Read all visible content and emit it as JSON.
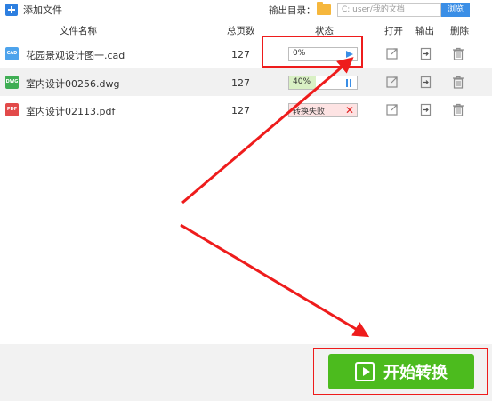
{
  "toolbar": {
    "add_file_label": "添加文件",
    "output_dir_label": "输出目录：",
    "output_path": "C:  user/我的文档",
    "browse_label": "浏览"
  },
  "table": {
    "headers": {
      "name": "文件名称",
      "pages": "总页数",
      "status": "状态",
      "open": "打开",
      "output": "输出",
      "delete": "删除"
    },
    "rows": [
      {
        "icon_text": "CAD",
        "icon_color": "#4da3ec",
        "name": "花园景观设计图一.cad",
        "pages": "127",
        "status_text": "0%",
        "progress": 0,
        "status_fill": "#ffffff",
        "status_action": "play-icon"
      },
      {
        "icon_text": "DWG",
        "icon_color": "#3fae54",
        "name": "室内设计00256.dwg",
        "pages": "127",
        "status_text": "40%",
        "progress": 0.4,
        "status_fill": "#d9f0c4",
        "status_action": "pause-icon"
      },
      {
        "icon_text": "PDF",
        "icon_color": "#e24a4a",
        "name": "室内设计02113.pdf",
        "pages": "127",
        "status_text": "转换失败",
        "progress": 1,
        "status_fill": "#fde3e3",
        "status_action": "close-icon"
      }
    ]
  },
  "start_button": {
    "label": "开始转换"
  },
  "colors": {
    "accent": "#3a8ee6",
    "start_green": "#4cbb1e",
    "annotation_red": "#ee1c1c"
  }
}
